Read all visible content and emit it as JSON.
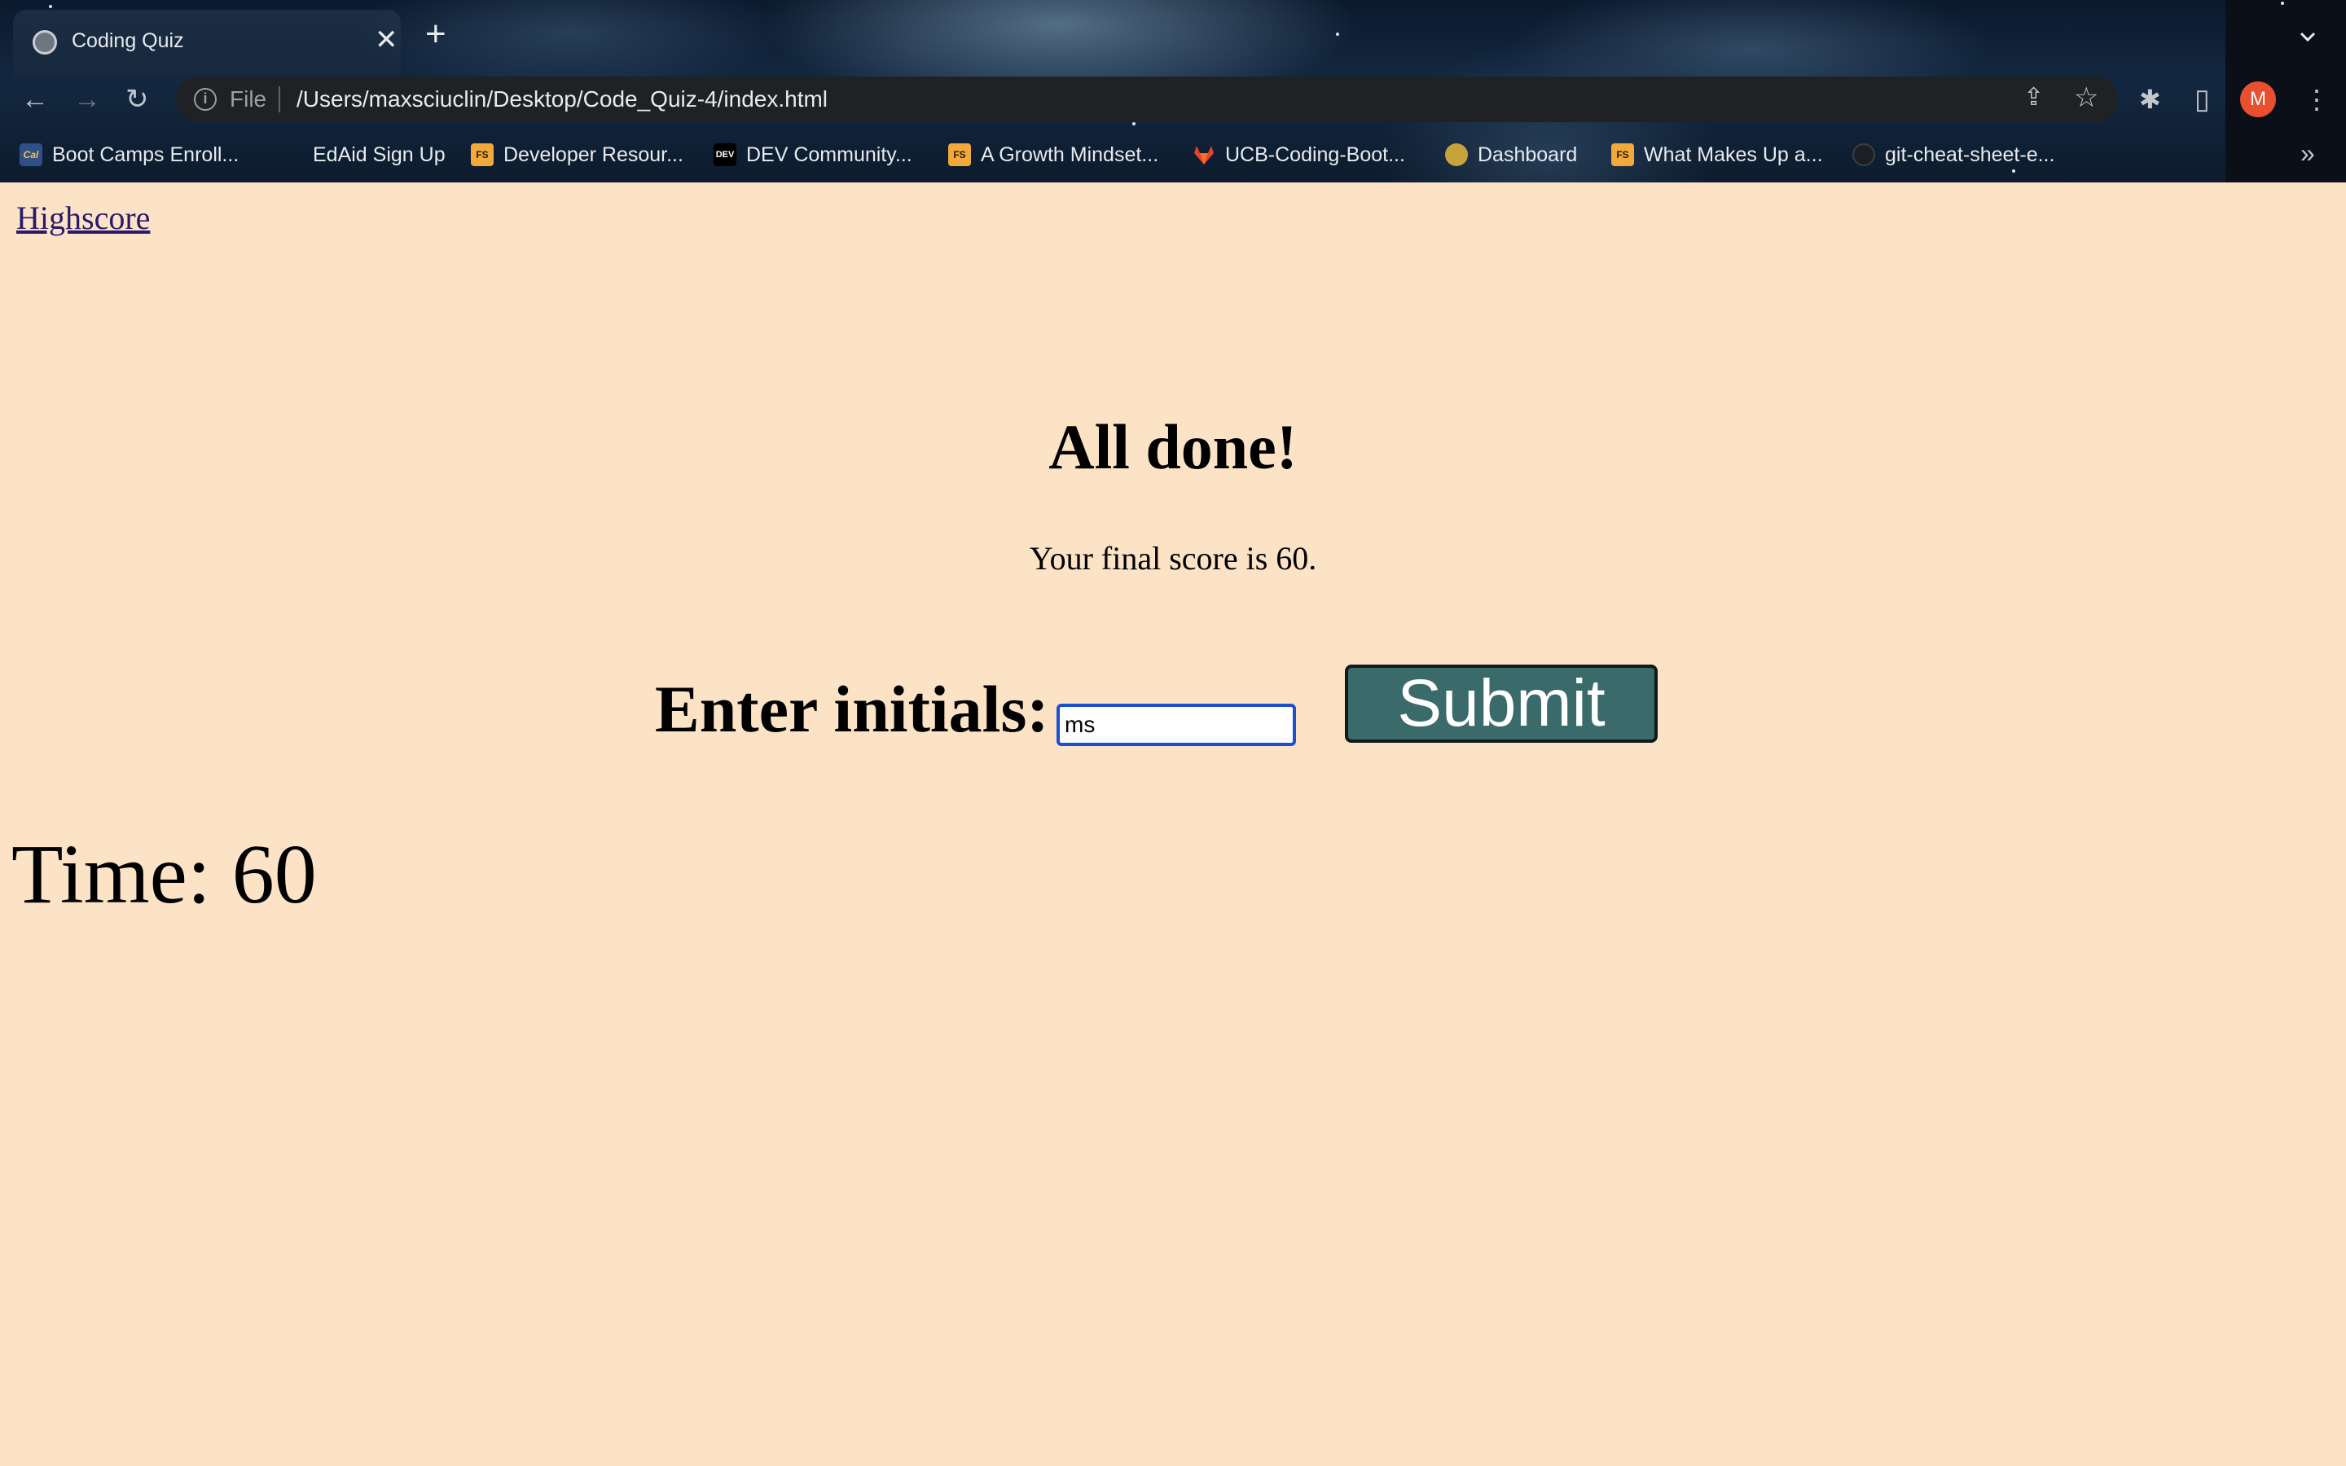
{
  "browser": {
    "tab": {
      "title": "Coding Quiz",
      "close_glyph": "✕",
      "favicon": "globe-icon"
    },
    "new_tab_glyph": "+",
    "nav": {
      "back": "←",
      "forward": "→",
      "reload": "↻"
    },
    "omnibox": {
      "info_glyph": "i",
      "scheme": "File",
      "url": "/Users/maxsciuclin/Desktop/Code_Quiz-4/index.html"
    },
    "toolbar": {
      "share_glyph": "⇪",
      "star_glyph": "☆",
      "extensions_glyph": "✱",
      "sidepanel_glyph": "▯",
      "menu_glyph": "⋮",
      "profile_initial": "M"
    },
    "bookmarks": [
      {
        "label": "Boot Camps Enroll...",
        "icon": "cal-icon",
        "color": "#2f4f86"
      },
      {
        "label": "EdAid Sign Up",
        "icon": "",
        "color": ""
      },
      {
        "label": "Developer Resour...",
        "icon": "fs-icon",
        "color": "#f0a93a"
      },
      {
        "label": "DEV Community...",
        "icon": "dev-icon",
        "color": "#000000"
      },
      {
        "label": "A Growth Mindset...",
        "icon": "fs-icon",
        "color": "#f0a93a"
      },
      {
        "label": "UCB-Coding-Boot...",
        "icon": "gitlab-icon",
        "color": "#e2432a"
      },
      {
        "label": "Dashboard",
        "icon": "dashboard-icon",
        "color": "#c8a23a"
      },
      {
        "label": "What Makes Up a...",
        "icon": "fs-icon",
        "color": "#f0a93a"
      },
      {
        "label": "git-cheat-sheet-e...",
        "icon": "github-icon",
        "color": "#1b1f23"
      }
    ],
    "bookmarks_overflow": "»"
  },
  "page": {
    "highscore_link": "Highscore",
    "heading": "All done!",
    "final_score_text": "Your final score is 60.",
    "initials_label": "Enter initials:",
    "initials_value": "ms",
    "submit_label": "Submit",
    "timer_text": "Time: 60"
  },
  "colors": {
    "page_background": "#fce3c6",
    "submit_background": "#3b6a6a",
    "input_focus_border": "#1a4fd4",
    "link": "#2a1a6b"
  }
}
